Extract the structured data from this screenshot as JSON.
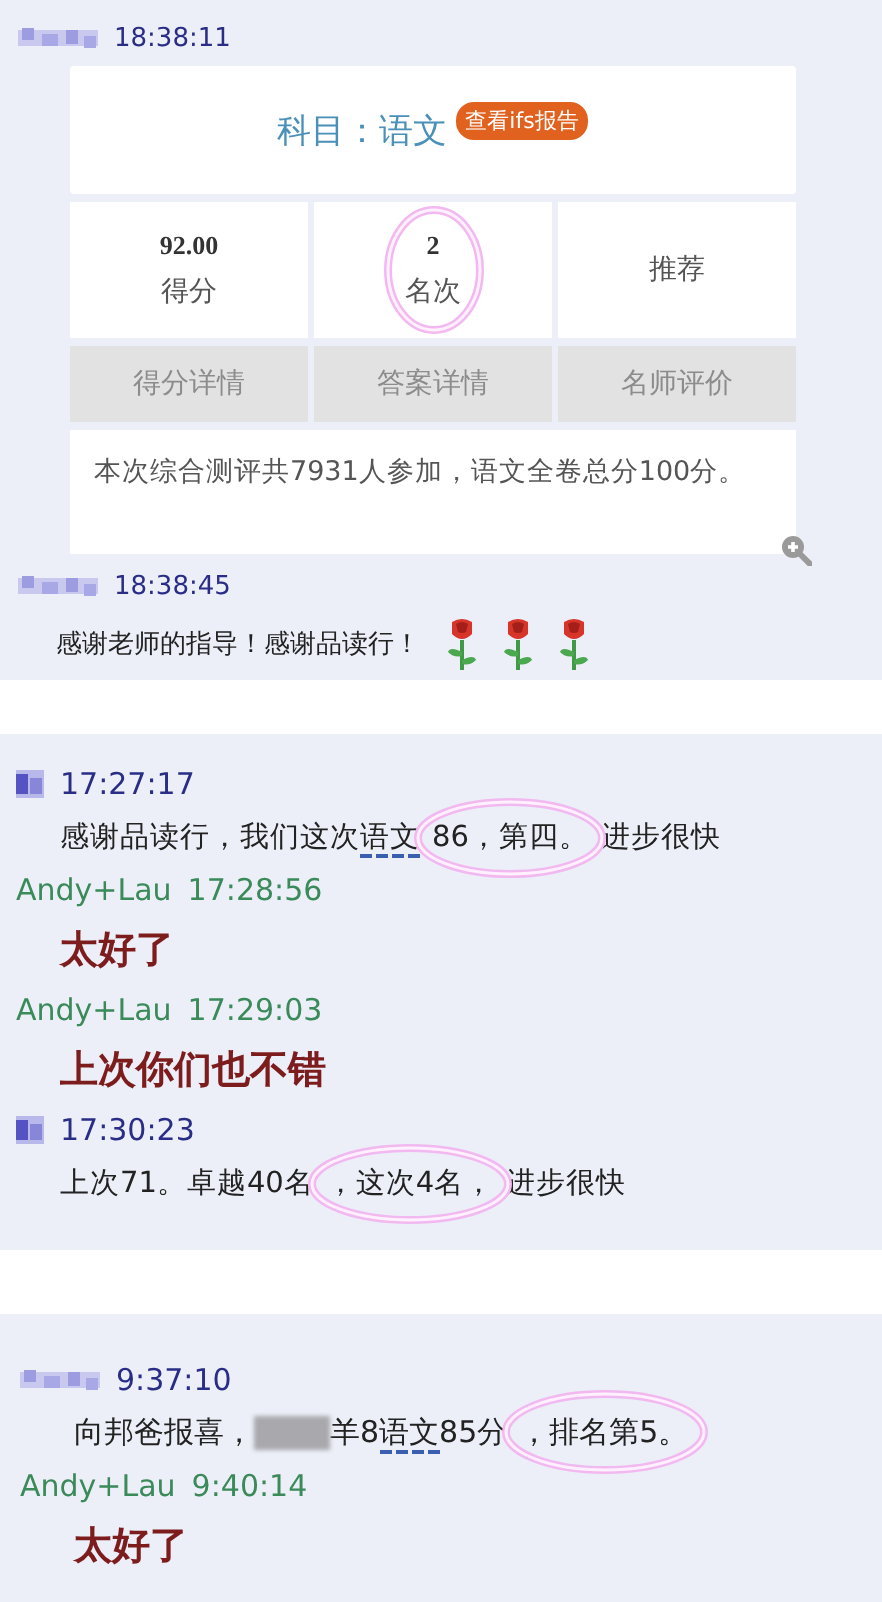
{
  "panels": [
    {
      "messages": [
        {
          "sender": {
            "kind": "pixelated-name"
          },
          "time": "18:38:11",
          "kind": "card",
          "card": {
            "subject": "科目：语文",
            "badge": "查看ifs报告",
            "stats": [
              {
                "kind": "plain",
                "value": "92.00",
                "label": "得分"
              },
              {
                "kind": "circled",
                "value": "2",
                "label": "名次"
              },
              {
                "kind": "plain",
                "label": "推荐"
              }
            ],
            "buttons": [
              {
                "label": "得分详情",
                "disabled": true
              },
              {
                "label": "答案详情",
                "disabled": true
              },
              {
                "label": "名师评价",
                "disabled": true
              }
            ],
            "info": "本次综合测评共7931人参加，语文全卷总分100分。"
          }
        },
        {
          "sender": {
            "kind": "pixelated-name"
          },
          "time": "18:38:45",
          "kind": "text",
          "segments": [
            {
              "kind": "plain",
              "text": "感谢老师的指导！感谢品读行！"
            }
          ],
          "icons": [
            {
              "kind": "rose"
            },
            {
              "kind": "rose"
            },
            {
              "kind": "rose"
            }
          ]
        }
      ]
    },
    {
      "messages": [
        {
          "sender": {
            "kind": "square-avatar"
          },
          "time": "17:27:17",
          "kind": "text",
          "segments": [
            {
              "kind": "plain",
              "text": "感谢品读行，我们这次"
            },
            {
              "kind": "underlined",
              "text": "语文"
            },
            {
              "kind": "circled",
              "text": "86，第四。"
            },
            {
              "kind": "plain",
              "text": "进步很快"
            }
          ]
        },
        {
          "sender": {
            "kind": "name",
            "name": "Andy+Lau"
          },
          "time": "17:28:56",
          "kind": "emphasis-text",
          "segments": [
            {
              "kind": "plain",
              "text": "太好了"
            }
          ]
        },
        {
          "sender": {
            "kind": "name",
            "name": "Andy+Lau"
          },
          "time": "17:29:03",
          "kind": "emphasis-text",
          "segments": [
            {
              "kind": "plain",
              "text": "上次你们也不错"
            }
          ]
        },
        {
          "sender": {
            "kind": "square-avatar"
          },
          "time": "17:30:23",
          "kind": "text",
          "segments": [
            {
              "kind": "plain",
              "text": "上次71。卓越40名"
            },
            {
              "kind": "circled",
              "text": "，这次4名，"
            },
            {
              "kind": "plain",
              "text": "进步很快"
            }
          ]
        }
      ]
    },
    {
      "messages": [
        {
          "sender": {
            "kind": "pixelated-name"
          },
          "time": "9:37:10",
          "kind": "text",
          "segments": [
            {
              "kind": "plain",
              "text": "向邦爸报喜，"
            },
            {
              "kind": "redacted"
            },
            {
              "kind": "plain",
              "text": "羊8"
            },
            {
              "kind": "underlined",
              "text": "语文"
            },
            {
              "kind": "plain",
              "text": "85分"
            },
            {
              "kind": "circled",
              "text": "，排名第5。"
            }
          ]
        },
        {
          "sender": {
            "kind": "name",
            "name": "Andy+Lau"
          },
          "time": "9:40:14",
          "kind": "emphasis-text",
          "segments": [
            {
              "kind": "plain",
              "text": "太好了"
            }
          ]
        }
      ]
    }
  ]
}
